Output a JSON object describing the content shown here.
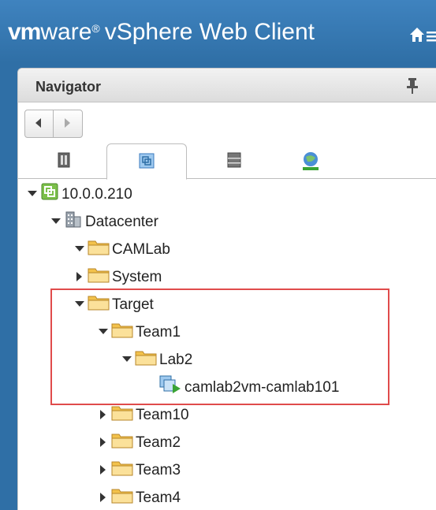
{
  "header": {
    "brand_vm": "vm",
    "brand_ware": "ware",
    "brand_reg": "®",
    "brand_product": "vSphere Web Client",
    "icons": [
      "home-icon",
      "menu-icon"
    ]
  },
  "navigator": {
    "title": "Navigator",
    "pin_icon": "pin-icon",
    "back_icon": "back-arrow-icon",
    "forward_icon": "forward-arrow-icon",
    "tabs": [
      {
        "name": "hosts-clusters-tab",
        "icon": "host-icon",
        "active": false
      },
      {
        "name": "vms-templates-tab",
        "icon": "vm-templates-icon",
        "active": true
      },
      {
        "name": "storage-tab",
        "icon": "storage-icon",
        "active": false
      },
      {
        "name": "networking-tab",
        "icon": "network-icon",
        "active": false
      }
    ]
  },
  "tree": [
    {
      "label": "10.0.0.210",
      "icon": "vcenter-icon",
      "expanded": true,
      "level": 0
    },
    {
      "label": "Datacenter",
      "icon": "datacenter-icon",
      "expanded": true,
      "level": 1
    },
    {
      "label": "CAMLab",
      "icon": "folder-icon",
      "expanded": true,
      "level": 2
    },
    {
      "label": "System",
      "icon": "folder-icon",
      "expanded": false,
      "level": 2
    },
    {
      "label": "Target",
      "icon": "folder-icon",
      "expanded": true,
      "level": 2
    },
    {
      "label": "Team1",
      "icon": "folder-icon",
      "expanded": true,
      "level": 3
    },
    {
      "label": "Lab2",
      "icon": "folder-icon",
      "expanded": true,
      "level": 4
    },
    {
      "label": "camlab2vm-camlab101",
      "icon": "vm-running-icon",
      "expanded": null,
      "level": 5
    },
    {
      "label": "Team10",
      "icon": "folder-icon",
      "expanded": false,
      "level": 3
    },
    {
      "label": "Team2",
      "icon": "folder-icon",
      "expanded": false,
      "level": 3
    },
    {
      "label": "Team3",
      "icon": "folder-icon",
      "expanded": false,
      "level": 3
    },
    {
      "label": "Team4",
      "icon": "folder-icon",
      "expanded": false,
      "level": 3
    }
  ],
  "colors": {
    "header_bg": "#2f6fa6",
    "folder": "#f3c24b",
    "highlight_border": "#e04b4b"
  }
}
